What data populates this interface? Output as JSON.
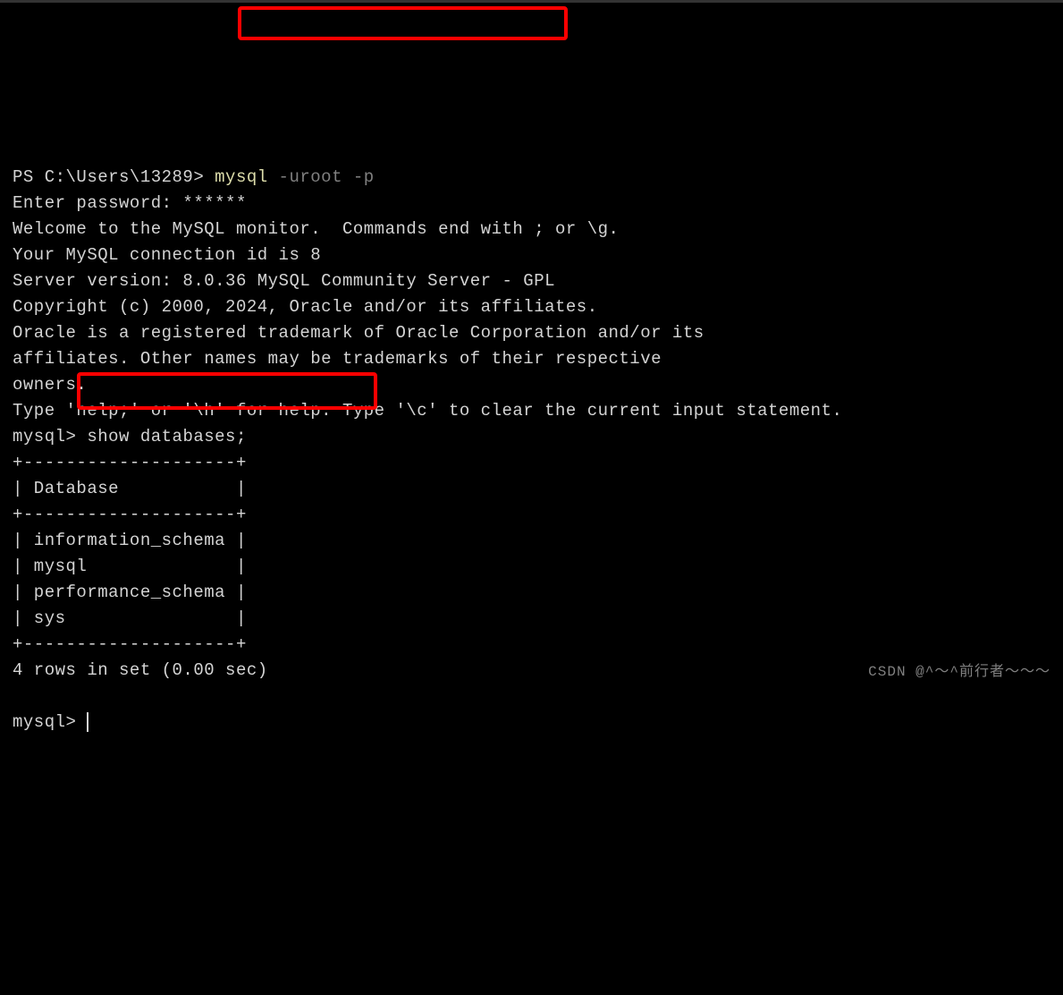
{
  "terminal": {
    "ps_prompt": "PS C:\\Users\\13289> ",
    "mysql_cmd": "mysql",
    "mysql_args": " -uroot -p",
    "lines": [
      "Enter password: ******",
      "Welcome to the MySQL monitor.  Commands end with ; or \\g.",
      "Your MySQL connection id is 8",
      "Server version: 8.0.36 MySQL Community Server - GPL",
      "",
      "Copyright (c) 2000, 2024, Oracle and/or its affiliates.",
      "",
      "Oracle is a registered trademark of Oracle Corporation and/or its",
      "affiliates. Other names may be trademarks of their respective",
      "owners.",
      "",
      "Type 'help;' or '\\h' for help. Type '\\c' to clear the current input statement.",
      ""
    ],
    "mysql_prompt": "mysql> ",
    "show_db_cmd": "show databases;",
    "table_border": "+--------------------+",
    "table_header": "| Database           |",
    "table_rows": [
      "| information_schema |",
      "| mysql              |",
      "| performance_schema |",
      "| sys                |"
    ],
    "result_summary": "4 rows in set (0.00 sec)",
    "watermark": "CSDN @^～^前行者～～～"
  }
}
